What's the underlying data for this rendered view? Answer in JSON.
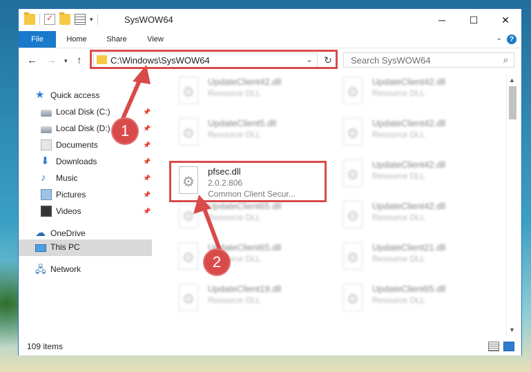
{
  "window": {
    "title": "SysWOW64",
    "controls": {
      "minimize": "─",
      "maximize": "☐",
      "close": "✕"
    }
  },
  "ribbon": {
    "tabs": [
      "File",
      "Home",
      "Share",
      "View"
    ],
    "help": "?"
  },
  "address": {
    "path": "C:\\Windows\\SysWOW64",
    "search_placeholder": "Search SysWOW64"
  },
  "nav": {
    "quick_access": "Quick access",
    "items": [
      "Local Disk (C:)",
      "Local Disk (D:)",
      "Documents",
      "Downloads",
      "Music",
      "Pictures",
      "Videos"
    ],
    "onedrive": "OneDrive",
    "this_pc": "This PC",
    "network": "Network"
  },
  "files": [
    {
      "name": "UpdateClient42.dll",
      "type": "Resource DLL"
    },
    {
      "name": "UpdateClient42.dll",
      "type": "Resource DLL"
    },
    {
      "name": "UpdateClient5.dll",
      "type": "Resource DLL"
    },
    {
      "name": "UpdateClient42.dll",
      "type": "Resource DLL"
    },
    {
      "name": "pfsec.dll",
      "version": "2.0.2.806",
      "desc": "Common Client Secur..."
    },
    {
      "name": "UpdateClient42.dll",
      "type": "Resource DLL"
    },
    {
      "name": "UpdateClient65.dll",
      "type": "Resource DLL"
    },
    {
      "name": "UpdateClient42.dll",
      "type": "Resource DLL"
    },
    {
      "name": "UpdateClient65.dll",
      "type": "Resource DLL"
    },
    {
      "name": "UpdateClient21.dll",
      "type": "Resource DLL"
    },
    {
      "name": "UpdateClient19.dll",
      "type": "Resource DLL"
    },
    {
      "name": "UpdateClient65.dll",
      "type": "Resource DLL"
    }
  ],
  "status": {
    "item_count": "109 items"
  },
  "annotations": {
    "step1": "1",
    "step2": "2",
    "highlight_color": "#d94b4b"
  }
}
